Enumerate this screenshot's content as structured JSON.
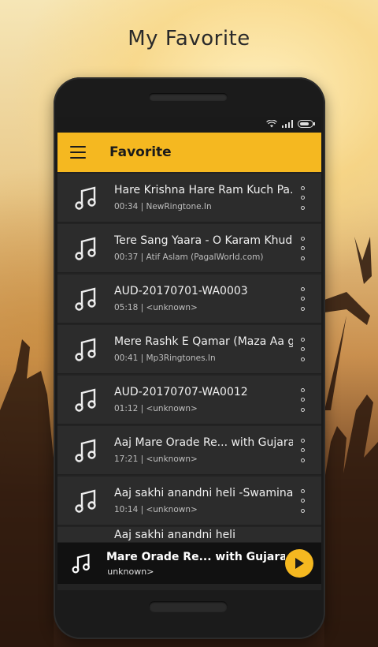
{
  "promo": {
    "title": "My Favorite"
  },
  "appbar": {
    "title": "Favorite",
    "menu_icon": "hamburger-menu-icon"
  },
  "accent_color": "#f5b820",
  "songs": [
    {
      "title": "Hare Krishna Hare Ram Kuch Pa...",
      "meta": "00:34 | NewRingtone.In"
    },
    {
      "title": "Tere Sang Yaara - O Karam Khud...",
      "meta": "00:37 | Atif Aslam (PagalWorld.com)"
    },
    {
      "title": "AUD-20170701-WA0003",
      "meta": "05:18 | <unknown>"
    },
    {
      "title": "Mere Rashk E Qamar (Maza Aa g...",
      "meta": "00:41 | Mp3Ringtones.In"
    },
    {
      "title": "AUD-20170707-WA0012",
      "meta": "01:12 | <unknown>"
    },
    {
      "title": "Aaj Mare Orade Re... with Gujarat...",
      "meta": "17:21 | <unknown>"
    },
    {
      "title": "Aaj sakhi anandni heli -Swamina...",
      "meta": "10:14 | <unknown>"
    },
    {
      "title": "Aaj sakhi anandni heli"
    }
  ],
  "player": {
    "title": "Mare Orade Re... with Gujarat",
    "artist": "<unknown>"
  }
}
